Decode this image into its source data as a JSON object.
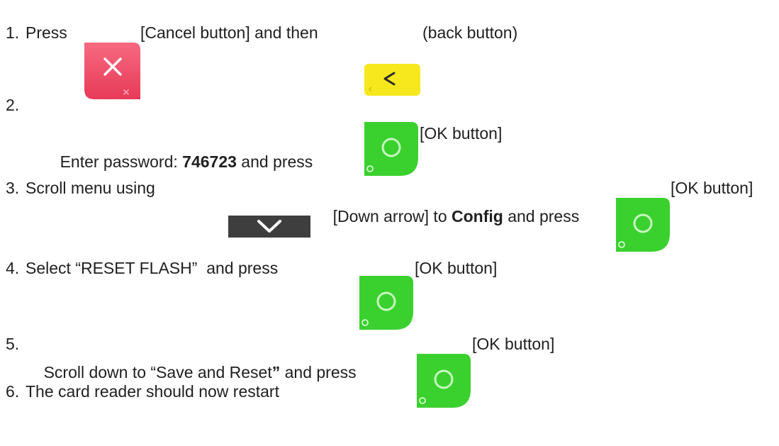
{
  "steps": [
    {
      "num": "1.",
      "press": "Press",
      "cancel_label": "[Cancel button] and then",
      "back_label": "(back button)"
    },
    {
      "num": "2.",
      "enter": "Enter password: ",
      "password": "746723",
      "and_press": " and press ",
      "ok_label": "[OK button]"
    },
    {
      "num": "3.",
      "scroll": "Scroll menu using ",
      "down_label": "[Down arrow] to ",
      "config": "Config",
      "and_press": " and press ",
      "ok_label": "[OK button]"
    },
    {
      "num": "4.",
      "text": "Select “RESET FLASH”  and press ",
      "ok_label": "[OK button]"
    },
    {
      "num": "5.",
      "text": "Scroll down to “Save and Reset",
      "quote": "”",
      "and_press": " and press ",
      "ok_label": "[OK button]"
    },
    {
      "num": "6.",
      "text": "The card reader should now restart"
    }
  ],
  "icons": {
    "cancel": "cancel-icon",
    "back": "back-arrow-icon",
    "ok": "ok-circle-icon",
    "down": "chevron-down-icon",
    "colors": {
      "cancel": "#f0506a",
      "back": "#f7ea1c",
      "ok": "#3ad12e",
      "down": "#3a3a3a"
    }
  }
}
